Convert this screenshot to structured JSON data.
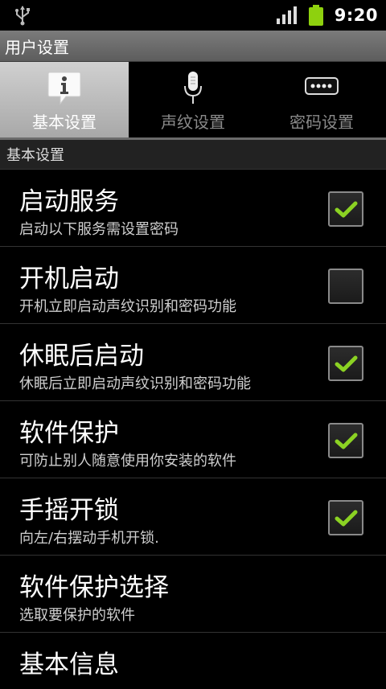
{
  "status_bar": {
    "time": "9:20",
    "icons": [
      "usb-icon",
      "signal-icon",
      "battery-icon"
    ],
    "battery_color": "#8ed10e"
  },
  "title_bar": {
    "title": "用户设置"
  },
  "tabs": [
    {
      "label": "基本设置",
      "icon": "info-icon",
      "active": true
    },
    {
      "label": "声纹设置",
      "icon": "microphone-icon",
      "active": false
    },
    {
      "label": "密码设置",
      "icon": "password-icon",
      "active": false
    }
  ],
  "section": {
    "header": "基本设置"
  },
  "settings": [
    {
      "title": "启动服务",
      "summary": "启动以下服务需设置密码",
      "checked": true
    },
    {
      "title": "开机启动",
      "summary": "开机立即启动声纹识别和密码功能",
      "checked": false
    },
    {
      "title": "休眠后启动",
      "summary": "休眠后立即启动声纹识别和密码功能",
      "checked": true
    },
    {
      "title": "软件保护",
      "summary": "可防止别人随意使用你安装的软件",
      "checked": true
    },
    {
      "title": "手摇开锁",
      "summary": "向左/右摆动手机开锁.",
      "checked": true
    },
    {
      "title": "软件保护选择",
      "summary": "选取要保护的软件"
    },
    {
      "title": "基本信息"
    }
  ],
  "colors": {
    "check": "#8bd223",
    "active_tab": "#bdbdbd",
    "title_bar": "#6c6c6c"
  }
}
